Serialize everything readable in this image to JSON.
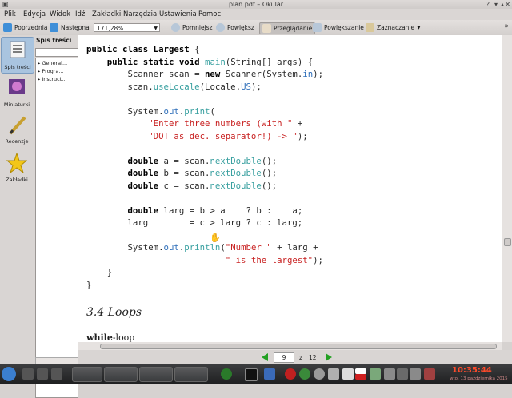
{
  "window": {
    "title": "plan.pdf – Okular"
  },
  "menu": [
    "Plik",
    "Edycja",
    "Widok",
    "Idź",
    "Zakładki",
    "Narzędzia",
    "Ustawienia",
    "Pomoc"
  ],
  "toolbar": {
    "prev": "Poprzednia",
    "next": "Następna",
    "zoom": "171,28%",
    "zoom_out": "Pomniejsz",
    "zoom_in": "Powiększ",
    "browse": "Przeglądanie",
    "magnify": "Powiększanie",
    "select": "Zaznaczanie"
  },
  "sidebar": {
    "tabs": [
      {
        "label": "Spis treści",
        "icon": "toc-icon"
      },
      {
        "label": "Miniaturki",
        "icon": "thumbnails-icon"
      },
      {
        "label": "Recenzje",
        "icon": "pencil-icon"
      },
      {
        "label": "Zakładki",
        "icon": "star-icon"
      }
    ],
    "toc_title": "Spis treści",
    "toc_items": [
      "General...",
      "Progra...",
      "Instruct..."
    ]
  },
  "document": {
    "code_lines": [
      "public class Largest {",
      "    public static void main(String[] args) {",
      "        Scanner scan = new Scanner(System.in);",
      "        scan.useLocale(Locale.US);",
      "",
      "        System.out.print(",
      "            \"Enter three numbers (with \" +",
      "            \"DOT as dec. separator!) -> \");",
      "",
      "        double a = scan.nextDouble();",
      "        double b = scan.nextDouble();",
      "        double c = scan.nextDouble();",
      "",
      "        double larg = b > a    ? b :    a;",
      "        larg        = c > larg ? c : larg;",
      "",
      "        System.out.println(\"Number \" + larg +",
      "                           \" is the largest\");",
      "    }",
      "}"
    ],
    "heading": "3.4 Loops",
    "subheading_bold": "while",
    "subheading_rest": "-loop"
  },
  "pagenav": {
    "current": "9",
    "separator": "z",
    "total": "12"
  },
  "taskbar": {
    "time": "10:35:44",
    "date": "wto, 13 października 2015"
  },
  "colors": {
    "keyword": "#7f0055",
    "string": "#c82020",
    "field": "#2f6fba",
    "clock": "#ff4a2a"
  }
}
